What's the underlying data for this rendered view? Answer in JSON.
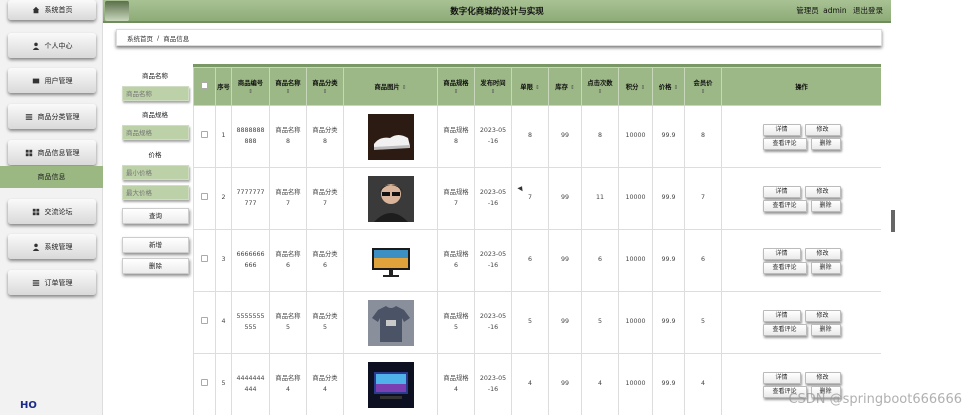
{
  "app": {
    "title": "数字化商城的设计与实现",
    "user_role": "管理员",
    "user_name": "admin",
    "logout": "退出登录"
  },
  "sidebar": {
    "items": [
      {
        "label": "系统首页",
        "icon": "home-icon"
      },
      {
        "label": "个人中心",
        "icon": "person-icon"
      },
      {
        "label": "用户管理",
        "icon": "card-icon"
      },
      {
        "label": "商品分类管理",
        "icon": "list-icon"
      },
      {
        "label": "商品信息管理",
        "icon": "grid-icon"
      },
      {
        "label": "商品信息",
        "icon": "",
        "active": true
      },
      {
        "label": "交流论坛",
        "icon": "apps-icon"
      },
      {
        "label": "系统管理",
        "icon": "person-icon"
      },
      {
        "label": "订单管理",
        "icon": "list-icon"
      }
    ],
    "logo_text": "HO"
  },
  "breadcrumb": {
    "home": "系统首页",
    "separator": "/",
    "current": "商品信息"
  },
  "search": {
    "name_label": "商品名称",
    "name_placeholder": "商品名称",
    "spec_label": "商品规格",
    "spec_placeholder": "商品规格",
    "price_label": "价格",
    "min_price_placeholder": "最小价格",
    "max_price_placeholder": "最大价格",
    "query_button": "查询",
    "add_button": "新增",
    "delete_button": "删除"
  },
  "table": {
    "headers": [
      "序号",
      "商品编号",
      "商品名称",
      "商品分类",
      "商品图片",
      "商品规格",
      "发布时间",
      "单限",
      "库存",
      "点击次数",
      "积分",
      "价格",
      "会员价",
      "操作"
    ],
    "sort_icon": "⇕",
    "actions": {
      "detail": "详情",
      "edit": "修改",
      "comments": "查看评论",
      "delete": "删除"
    },
    "rows": [
      {
        "index": "1",
        "code_a": "8888888",
        "code_b": "888",
        "name_a": "商品名称",
        "name_b": "8",
        "cat_a": "商品分类",
        "cat_b": "8",
        "image": "shoe",
        "spec_a": "商品规格",
        "spec_b": "8",
        "date_a": "2023-05",
        "date_b": "-16",
        "limit": "8",
        "stock": "99",
        "clicks": "8",
        "points": "10000",
        "price": "99.9",
        "member_price": "8"
      },
      {
        "index": "2",
        "code_a": "7777777",
        "code_b": "777",
        "name_a": "商品名称",
        "name_b": "7",
        "cat_a": "商品分类",
        "cat_b": "7",
        "image": "portrait",
        "spec_a": "商品规格",
        "spec_b": "7",
        "date_a": "2023-05",
        "date_b": "-16",
        "limit": "7",
        "stock": "99",
        "clicks": "11",
        "points": "10000",
        "price": "99.9",
        "member_price": "7"
      },
      {
        "index": "3",
        "code_a": "6666666",
        "code_b": "666",
        "name_a": "商品名称",
        "name_b": "6",
        "cat_a": "商品分类",
        "cat_b": "6",
        "image": "monitor",
        "spec_a": "商品规格",
        "spec_b": "6",
        "date_a": "2023-05",
        "date_b": "-16",
        "limit": "6",
        "stock": "99",
        "clicks": "6",
        "points": "10000",
        "price": "99.9",
        "member_price": "6"
      },
      {
        "index": "4",
        "code_a": "5555555",
        "code_b": "555",
        "name_a": "商品名称",
        "name_b": "5",
        "cat_a": "商品分类",
        "cat_b": "5",
        "image": "tshirt",
        "spec_a": "商品规格",
        "spec_b": "5",
        "date_a": "2023-05",
        "date_b": "-16",
        "limit": "5",
        "stock": "99",
        "clicks": "5",
        "points": "10000",
        "price": "99.9",
        "member_price": "5"
      },
      {
        "index": "5",
        "code_a": "4444444",
        "code_b": "444",
        "name_a": "商品名称",
        "name_b": "4",
        "cat_a": "商品分类",
        "cat_b": "4",
        "image": "tv",
        "spec_a": "商品规格",
        "spec_b": "4",
        "date_a": "2023-05",
        "date_b": "-16",
        "limit": "4",
        "stock": "99",
        "clicks": "4",
        "points": "10000",
        "price": "99.9",
        "member_price": "4"
      }
    ]
  },
  "watermark": "CSDN @springboot666666",
  "colors": {
    "accent": "#9db887",
    "header_bar": "#8dab77",
    "sidebar_active": "#9bb883",
    "input_fill": "#bcd1a7"
  }
}
